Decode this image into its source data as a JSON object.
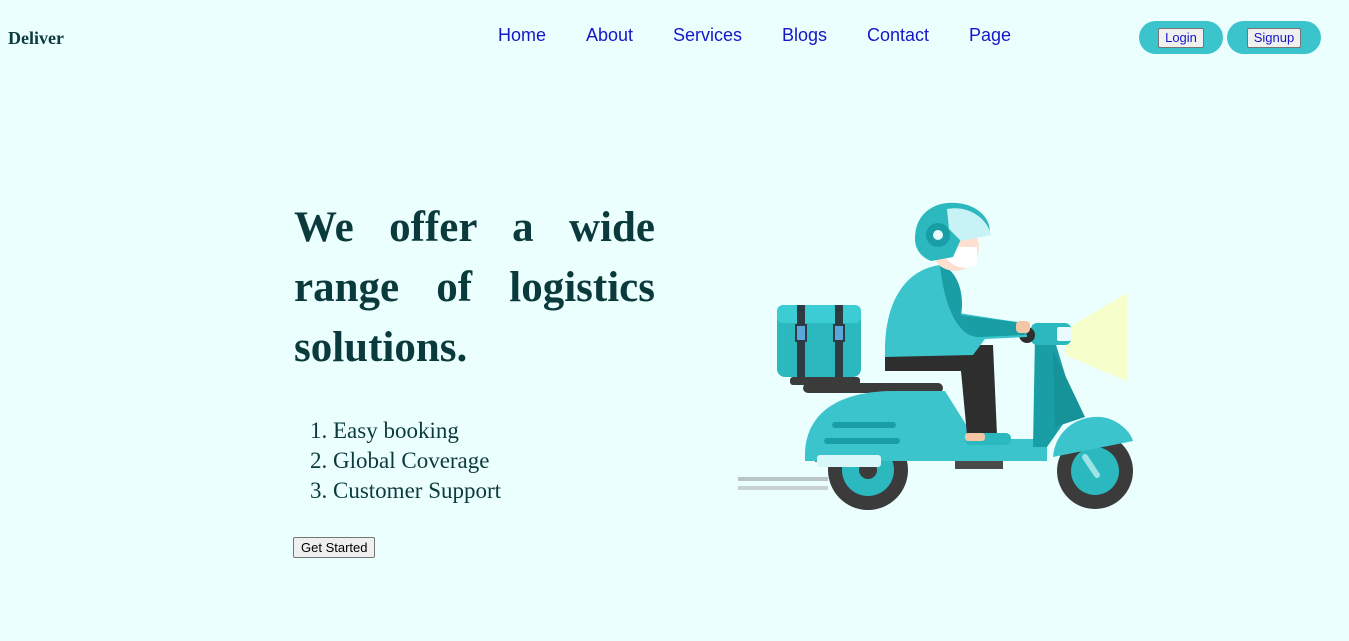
{
  "brand": "Deliver",
  "nav": [
    {
      "label": "Home"
    },
    {
      "label": "About"
    },
    {
      "label": "Services"
    },
    {
      "label": "Blogs"
    },
    {
      "label": "Contact"
    },
    {
      "label": "Page"
    }
  ],
  "auth": {
    "login_label": "Login",
    "signup_label": "Signup"
  },
  "hero": {
    "title": "We offer a wide range of logistics solutions.",
    "features": [
      "Easy booking",
      "Global Coverage",
      "Customer Support"
    ],
    "cta_label": "Get Started"
  },
  "colors": {
    "background": "#ebffff",
    "heading": "#0b3a3c",
    "nav_link": "#1616c8",
    "accent": "#3cc4cc"
  },
  "illustration": {
    "icon": "delivery-scooter-illustration"
  }
}
